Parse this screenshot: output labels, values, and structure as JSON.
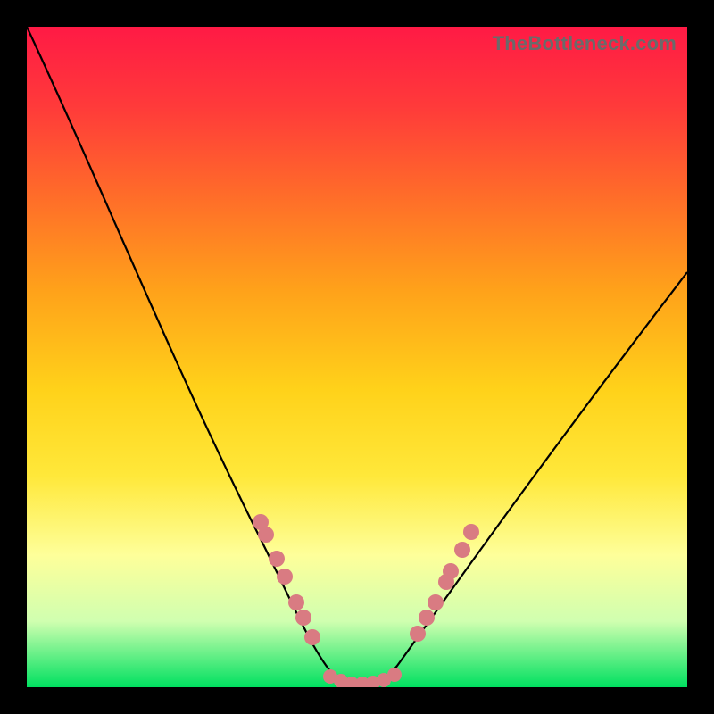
{
  "watermark": "TheBottleneck.com",
  "chart_data": {
    "type": "line",
    "title": "",
    "xlabel": "",
    "ylabel": "",
    "xlim": [
      0,
      100
    ],
    "ylim": [
      0,
      100
    ],
    "grid": false,
    "series": [
      {
        "name": "bottleneck-curve",
        "x": [
          0,
          5,
          10,
          15,
          20,
          25,
          30,
          35,
          40,
          45,
          47,
          50,
          53,
          55,
          60,
          65,
          70,
          75,
          80,
          85,
          90,
          95,
          100
        ],
        "y": [
          100,
          90,
          79,
          68,
          57,
          46,
          36,
          26,
          16,
          6,
          2,
          0,
          2,
          6,
          14,
          22,
          30,
          37,
          44,
          50,
          55,
          60,
          64
        ]
      }
    ],
    "annotations": {
      "marker_clusters": [
        {
          "side": "left",
          "x_range": [
            35,
            44
          ],
          "y_range": [
            7,
            27
          ]
        },
        {
          "side": "right",
          "x_range": [
            56,
            66
          ],
          "y_range": [
            7,
            27
          ]
        },
        {
          "side": "bottom",
          "x_range": [
            45,
            55
          ],
          "y_range": [
            0,
            3
          ]
        }
      ],
      "marker_color": "#d97b82"
    },
    "colors": {
      "gradient_top": "#ff1a45",
      "gradient_bottom": "#00e060",
      "curve": "#000000",
      "frame": "#000000"
    }
  }
}
